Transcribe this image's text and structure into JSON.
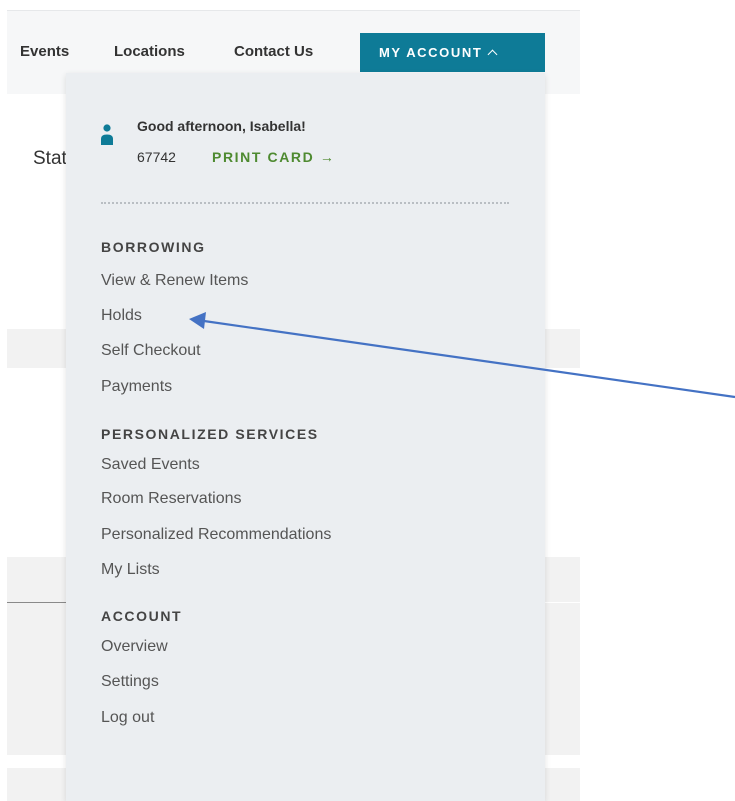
{
  "nav": {
    "events": "Events",
    "locations": "Locations",
    "contact": "Contact Us",
    "my_account": "MY ACCOUNT"
  },
  "page": {
    "partial_heading": "Stat"
  },
  "account_menu": {
    "greeting": "Good afternoon, Isabella!",
    "card_number": "67742",
    "print_card": "PRINT CARD →",
    "sections": {
      "borrowing": {
        "heading": "BORROWING",
        "items": [
          "View & Renew Items",
          "Holds",
          "Self Checkout",
          "Payments"
        ]
      },
      "personalized": {
        "heading": "PERSONALIZED SERVICES",
        "items": [
          "Saved Events",
          "Room Reservations",
          "Personalized Recommendations",
          "My Lists"
        ]
      },
      "account": {
        "heading": "ACCOUNT",
        "items": [
          "Overview",
          "Settings",
          "Log out"
        ]
      }
    }
  },
  "colors": {
    "accent": "#0e7b97",
    "print_card": "#4e8a30",
    "menu_bg": "#ebeef1",
    "annotation_arrow": "#4472c4"
  },
  "icons": {
    "user": "user-icon",
    "chevron": "chevron-up-icon",
    "annotation": "arrow-icon"
  }
}
